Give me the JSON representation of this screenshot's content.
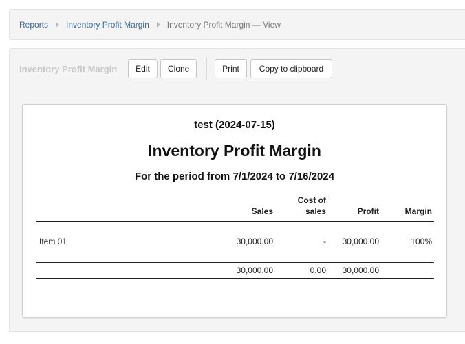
{
  "breadcrumb": {
    "items": [
      "Reports",
      "Inventory Profit Margin"
    ],
    "current": "Inventory Profit Margin — View"
  },
  "toolbar": {
    "title": "Inventory Profit Margin",
    "edit_label": "Edit",
    "clone_label": "Clone",
    "print_label": "Print",
    "copy_label": "Copy to clipboard"
  },
  "report": {
    "company": "test (2024-07-15)",
    "title": "Inventory Profit Margin",
    "period": "For the period from 7/1/2024 to 7/16/2024",
    "columns": {
      "sales": "Sales",
      "cost_line1": "Cost of",
      "cost_line2": "sales",
      "profit": "Profit",
      "margin": "Margin"
    },
    "rows": [
      {
        "name": "Item 01",
        "sales": "30,000.00",
        "cost": "-",
        "profit": "30,000.00",
        "margin": "100%"
      }
    ],
    "totals": {
      "sales": "30,000.00",
      "cost": "0.00",
      "profit": "30,000.00",
      "margin": ""
    }
  }
}
